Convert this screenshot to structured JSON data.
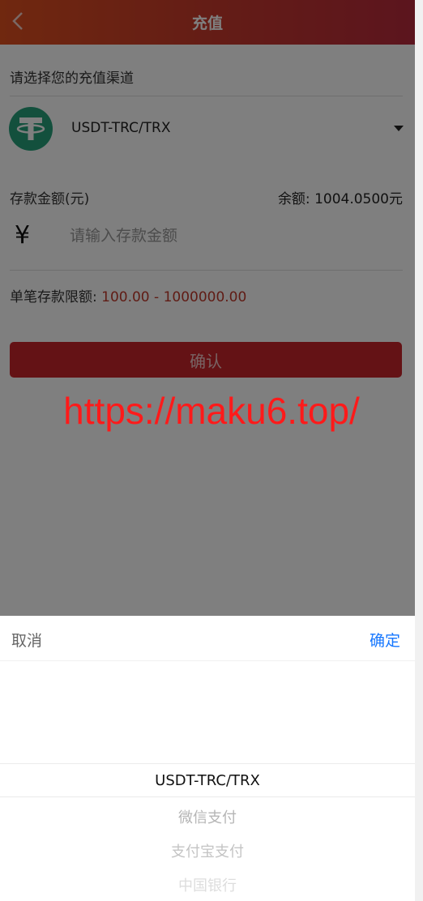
{
  "header": {
    "title": "充值",
    "back_icon": "chevron-left-icon"
  },
  "channel": {
    "section_label": "请选择您的充值渠道",
    "selected_name": "USDT-TRC/TRX",
    "logo_icon": "tether-icon",
    "logo_color": "#26a17b",
    "dropdown_icon": "caret-down-icon"
  },
  "amount": {
    "label": "存款金额(元)",
    "balance": "余额: 1004.0500元",
    "currency_symbol": "¥",
    "input_value": "",
    "input_placeholder": "请输入存款金额"
  },
  "limit": {
    "label": "单笔存款限额:",
    "range": "100.00 - 1000000.00",
    "color": "#c0392b"
  },
  "confirm_button": {
    "label": "确认",
    "color": "#c8242b"
  },
  "watermark": "https://maku6.top/",
  "picker": {
    "cancel_label": "取消",
    "confirm_label": "确定",
    "confirm_color": "#1677ff",
    "options": [
      "USDT-TRC/TRX",
      "微信支付",
      "支付宝支付",
      "中国银行"
    ]
  }
}
